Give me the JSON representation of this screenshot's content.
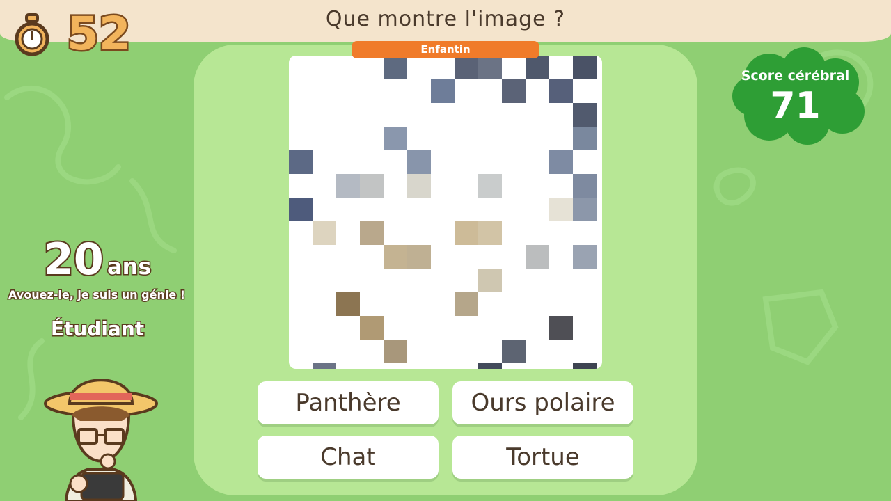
{
  "header": {
    "question": "Que montre l'image ?",
    "timer_value": "52",
    "timer_icon": "stopwatch-icon"
  },
  "difficulty": "Enfantin",
  "score": {
    "label": "Score cérébral",
    "value": "71"
  },
  "result": {
    "age": "20",
    "age_unit": "ans",
    "comment": "Avouez-le, je suis un génie !",
    "rank": "Étudiant"
  },
  "answers": [
    {
      "label": "Panthère"
    },
    {
      "label": "Ours polaire"
    },
    {
      "label": "Chat"
    },
    {
      "label": "Tortue"
    }
  ],
  "colors": {
    "background": "#8fcf73",
    "panel": "#b7e795",
    "top_bar": "#f4e4cc",
    "difficulty_badge": "#f07b2a",
    "score_cloud": "#2e9e35",
    "text_brown": "#4a3a2c"
  }
}
